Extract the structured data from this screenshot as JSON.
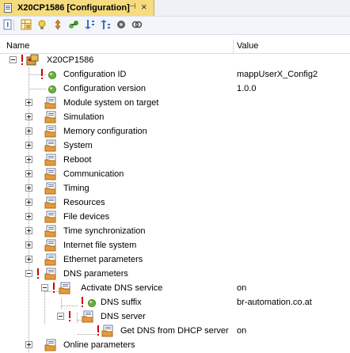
{
  "tab": {
    "title": "X20CP1586 [Configuration]",
    "pin_icon": "pin-icon",
    "close_symbol": "×"
  },
  "toolbar": {
    "icons": [
      "info-icon",
      "grid-icon",
      "bulb-icon",
      "move-icon",
      "connect-icon",
      "sort-down-icon",
      "sort-up-icon",
      "circle-icon",
      "link-icon"
    ]
  },
  "columns": {
    "name": "Name",
    "value": "Value"
  },
  "tree": {
    "root": {
      "label": "X20CP1586"
    },
    "config_id": {
      "label": "Configuration ID",
      "value": "mappUserX_Config2"
    },
    "config_version": {
      "label": "Configuration version",
      "value": "1.0.0"
    },
    "module_system": {
      "label": "Module system on target"
    },
    "simulation": {
      "label": "Simulation"
    },
    "memory": {
      "label": "Memory configuration"
    },
    "system": {
      "label": "System"
    },
    "reboot": {
      "label": "Reboot"
    },
    "communication": {
      "label": "Communication"
    },
    "timing": {
      "label": "Timing"
    },
    "resources": {
      "label": "Resources"
    },
    "file_devices": {
      "label": "File devices"
    },
    "time_sync": {
      "label": "Time synchronization"
    },
    "internet_fs": {
      "label": "Internet file system"
    },
    "ethernet": {
      "label": "Ethernet parameters"
    },
    "dns": {
      "label": "DNS parameters"
    },
    "activate_dns": {
      "label": "Activate DNS service",
      "value": "on"
    },
    "dns_suffix": {
      "label": "DNS suffix",
      "value": "br-automation.co.at"
    },
    "dns_server": {
      "label": "DNS server"
    },
    "dns_dhcp": {
      "label": "Get DNS from DHCP server",
      "value": "on"
    },
    "online": {
      "label": "Online parameters"
    }
  },
  "colors": {
    "tab_bg": "#f6dc7e",
    "error_mark": "#d00000",
    "leaf_green": "#5aa02c",
    "folder_orange": "#d87a1e"
  }
}
